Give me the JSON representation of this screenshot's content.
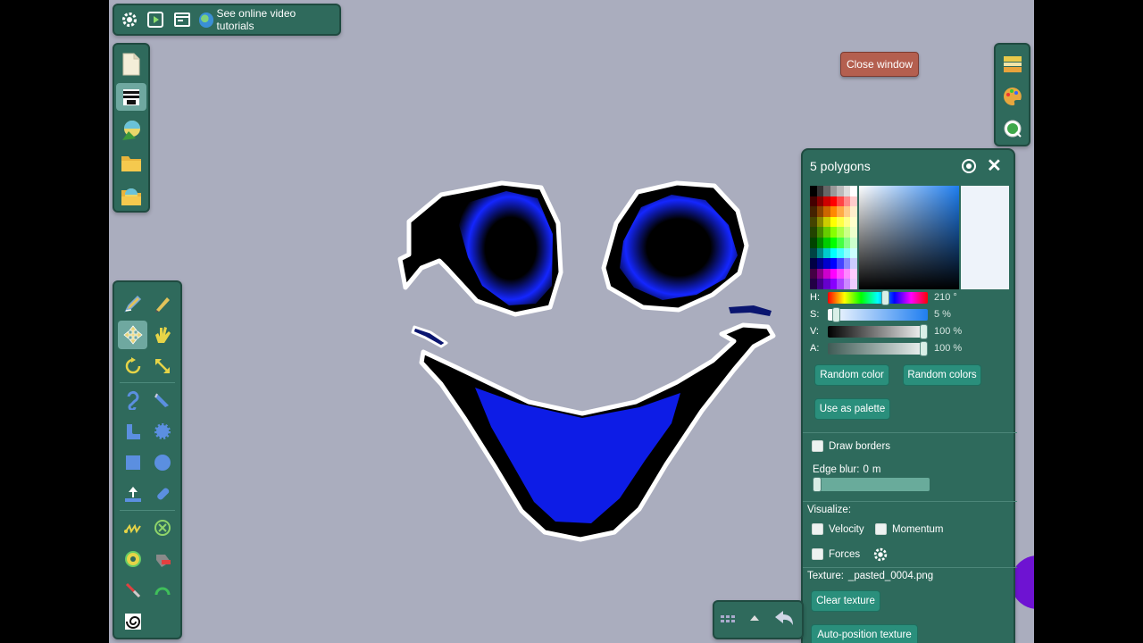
{
  "top_bar": {
    "settings_icon": "gear-icon",
    "play_icon": "play-icon",
    "window_icon": "window-icon",
    "tutorials_label": "See online video tutorials"
  },
  "close_window_label": "Close window",
  "file_panel": {
    "items": [
      "new-document-icon",
      "erase-scene-icon",
      "scene-thumbnail-icon",
      "open-folder-icon",
      "load-scene-icon"
    ]
  },
  "properties": {
    "title": "5 polygons",
    "color": {
      "h_label": "H:",
      "h_value": "210 °",
      "h": 210,
      "s_label": "S:",
      "s_value": "5 %",
      "s": 5,
      "v_label": "V:",
      "v_value": "100 %",
      "v": 100,
      "a_label": "A:",
      "a_value": "100 %",
      "a": 100
    },
    "random_color_label": "Random color",
    "random_colors_label": "Random colors",
    "use_as_palette_label": "Use as palette",
    "draw_borders_label": "Draw borders",
    "edge_blur_label": "Edge blur:",
    "edge_blur_value": "0",
    "edge_blur_unit": "m",
    "visualize_label": "Visualize:",
    "velocity_label": "Velocity",
    "momentum_label": "Momentum",
    "forces_label": "Forces",
    "texture_label": "Texture:",
    "texture_value": "_pasted_0004.png",
    "clear_texture_label": "Clear texture",
    "auto_position_label": "Auto-position texture"
  },
  "colors": {
    "panel": "#2f6a5c",
    "canvas": "#aaadbe",
    "shape_blue": "#0a1ee0",
    "close_btn": "#b45f4f"
  }
}
